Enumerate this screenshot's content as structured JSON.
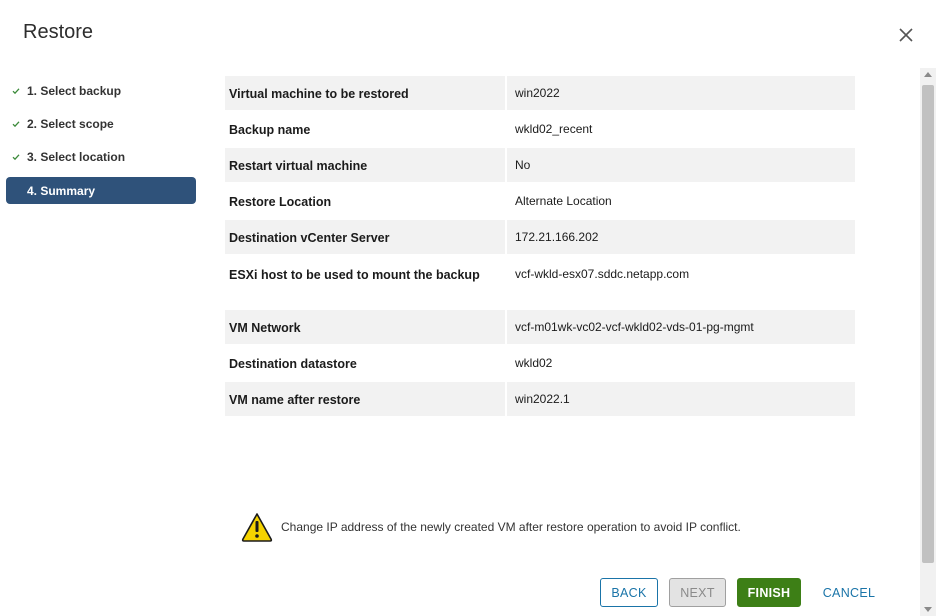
{
  "dialog": {
    "title": "Restore"
  },
  "steps": [
    {
      "label": "1. Select backup",
      "done": true
    },
    {
      "label": "2. Select scope",
      "done": true
    },
    {
      "label": "3. Select location",
      "done": true
    },
    {
      "label": "4. Summary",
      "active": true
    }
  ],
  "summary": [
    {
      "key": "Virtual machine to be restored",
      "value": "win2022"
    },
    {
      "key": "Backup name",
      "value": "wkld02_recent"
    },
    {
      "key": "Restart virtual machine",
      "value": "No"
    },
    {
      "key": "Restore Location",
      "value": "Alternate Location"
    },
    {
      "key": "Destination vCenter Server",
      "value": "172.21.166.202"
    },
    {
      "key": "ESXi host to be used to mount the backup",
      "value": "vcf-wkld-esx07.sddc.netapp.com"
    },
    {
      "key": "VM Network",
      "value": "vcf-m01wk-vc02-vcf-wkld02-vds-01-pg-mgmt"
    },
    {
      "key": "Destination datastore",
      "value": "wkld02"
    },
    {
      "key": "VM name after restore",
      "value": "win2022.1"
    }
  ],
  "warning": {
    "text": "Change IP address of the newly created VM after restore operation to avoid IP conflict."
  },
  "buttons": {
    "back": "BACK",
    "next": "NEXT",
    "finish": "FINISH",
    "cancel": "CANCEL"
  },
  "colors": {
    "accent": "#2f527a",
    "finish": "#3d7f16",
    "link": "#1a74a8",
    "check": "#3b8a3a"
  }
}
